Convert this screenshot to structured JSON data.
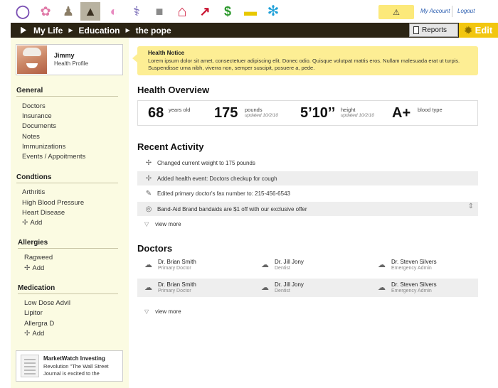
{
  "topbar": {
    "icons": [
      {
        "name": "color-wheel-icon",
        "glyph": "◯",
        "color": "#7a4fb3"
      },
      {
        "name": "baby-icon",
        "glyph": "✿",
        "color": "#e07aa8"
      },
      {
        "name": "family-icon",
        "glyph": "♟",
        "color": "#8a7d66"
      },
      {
        "name": "graduation-cap-icon",
        "glyph": "▲",
        "color": "#3a3020"
      },
      {
        "name": "globe-icon",
        "glyph": "◐",
        "color": "#e88ac0"
      },
      {
        "name": "caduceus-icon",
        "glyph": "⚕",
        "color": "#5a4aa8"
      },
      {
        "name": "lock-icon",
        "glyph": "■",
        "color": "#8a8a8a"
      },
      {
        "name": "house-icon",
        "glyph": "⌂",
        "color": "#d22b4a"
      },
      {
        "name": "trend-arrow-icon",
        "glyph": "↗",
        "color": "#c8102e"
      },
      {
        "name": "dollar-icon",
        "glyph": "$",
        "color": "#2e9a2e"
      },
      {
        "name": "briefcase-icon",
        "glyph": "▬",
        "color": "#e8c800"
      },
      {
        "name": "snowflake-icon",
        "glyph": "✻",
        "color": "#1ea0d8"
      }
    ],
    "warning_glyph": "⚠",
    "my_account": "My Account",
    "logout": "Logout"
  },
  "breadcrumb": {
    "items": [
      "My Life",
      "Education",
      "the pope"
    ],
    "separator": "▶",
    "reports_label": "Reports",
    "edit_label": "Edit"
  },
  "profile": {
    "name": "Jimmy",
    "subtitle": "Health Profile"
  },
  "sidebar": {
    "general": {
      "title": "General",
      "items": [
        "Doctors",
        "Insurance",
        "Documents",
        "Notes",
        "Immunizations",
        "Events / Appoitments"
      ]
    },
    "conditions": {
      "title": "Condtions",
      "items": [
        "Arthritis",
        "High Blood Pressure",
        "Heart Disease"
      ],
      "add": "Add"
    },
    "allergies": {
      "title": "Allergies",
      "items": [
        "Ragweed"
      ],
      "add": "Add"
    },
    "medication": {
      "title": "Medication",
      "items": [
        "Low Dose Advil",
        "Lipitor",
        "Allergra D"
      ],
      "add": "Add"
    },
    "ad": {
      "title": "MarketWatch Investing",
      "text": "Revolution \"The Wall Street Journal is excited to the"
    }
  },
  "notice": {
    "title": "Health Notice",
    "body": "Lorem ipsum dolor sit amet, consectetuer adipiscing elit. Donec odio. Quisque volutpat mattis eros. Nullam malesuada erat ut turpis. Suspendisse urna nibh, viverra non, semper suscipit, posuere a, pede."
  },
  "overview": {
    "title": "Health Overview",
    "age": {
      "value": "68",
      "label": "years old"
    },
    "weight": {
      "value": "175",
      "label": "pounds",
      "updated": "updated 10/2/10"
    },
    "height": {
      "value": "5’10’’",
      "label": "height",
      "updated": "updated 10/2/10"
    },
    "blood": {
      "value": "A+",
      "label": "blood type"
    }
  },
  "activity": {
    "title": "Recent Activity",
    "items": [
      {
        "icon": "✢",
        "text": "Changed current weight to 175 pounds"
      },
      {
        "icon": "✢",
        "text": "Added health event: Doctors checkup for cough"
      },
      {
        "icon": "✎",
        "text": "Edited primary doctor's fax number to: 215-456-6543"
      },
      {
        "icon": "◎",
        "text": "Band-Aid Brand bandaids are $1 off with our exclusive offer"
      }
    ],
    "view_more": "view more",
    "view_more_glyph": "▽",
    "scroll_glyph": "⇕"
  },
  "doctors": {
    "title": "Doctors",
    "icon_glyph": "☁",
    "rows": [
      [
        {
          "name": "Dr. Brian Smith",
          "role": "Primary Doctor"
        },
        {
          "name": "Dr. Jill Jony",
          "role": "Dentist"
        },
        {
          "name": "Dr. Steven Silvers",
          "role": "Emergency Admin"
        }
      ],
      [
        {
          "name": "Dr. Brian Smith",
          "role": "Primary Doctor"
        },
        {
          "name": "Dr. Jill Jony",
          "role": "Dentist"
        },
        {
          "name": "Dr. Steven Silvers",
          "role": "Emergency Admin"
        }
      ]
    ],
    "view_more": "view more"
  }
}
